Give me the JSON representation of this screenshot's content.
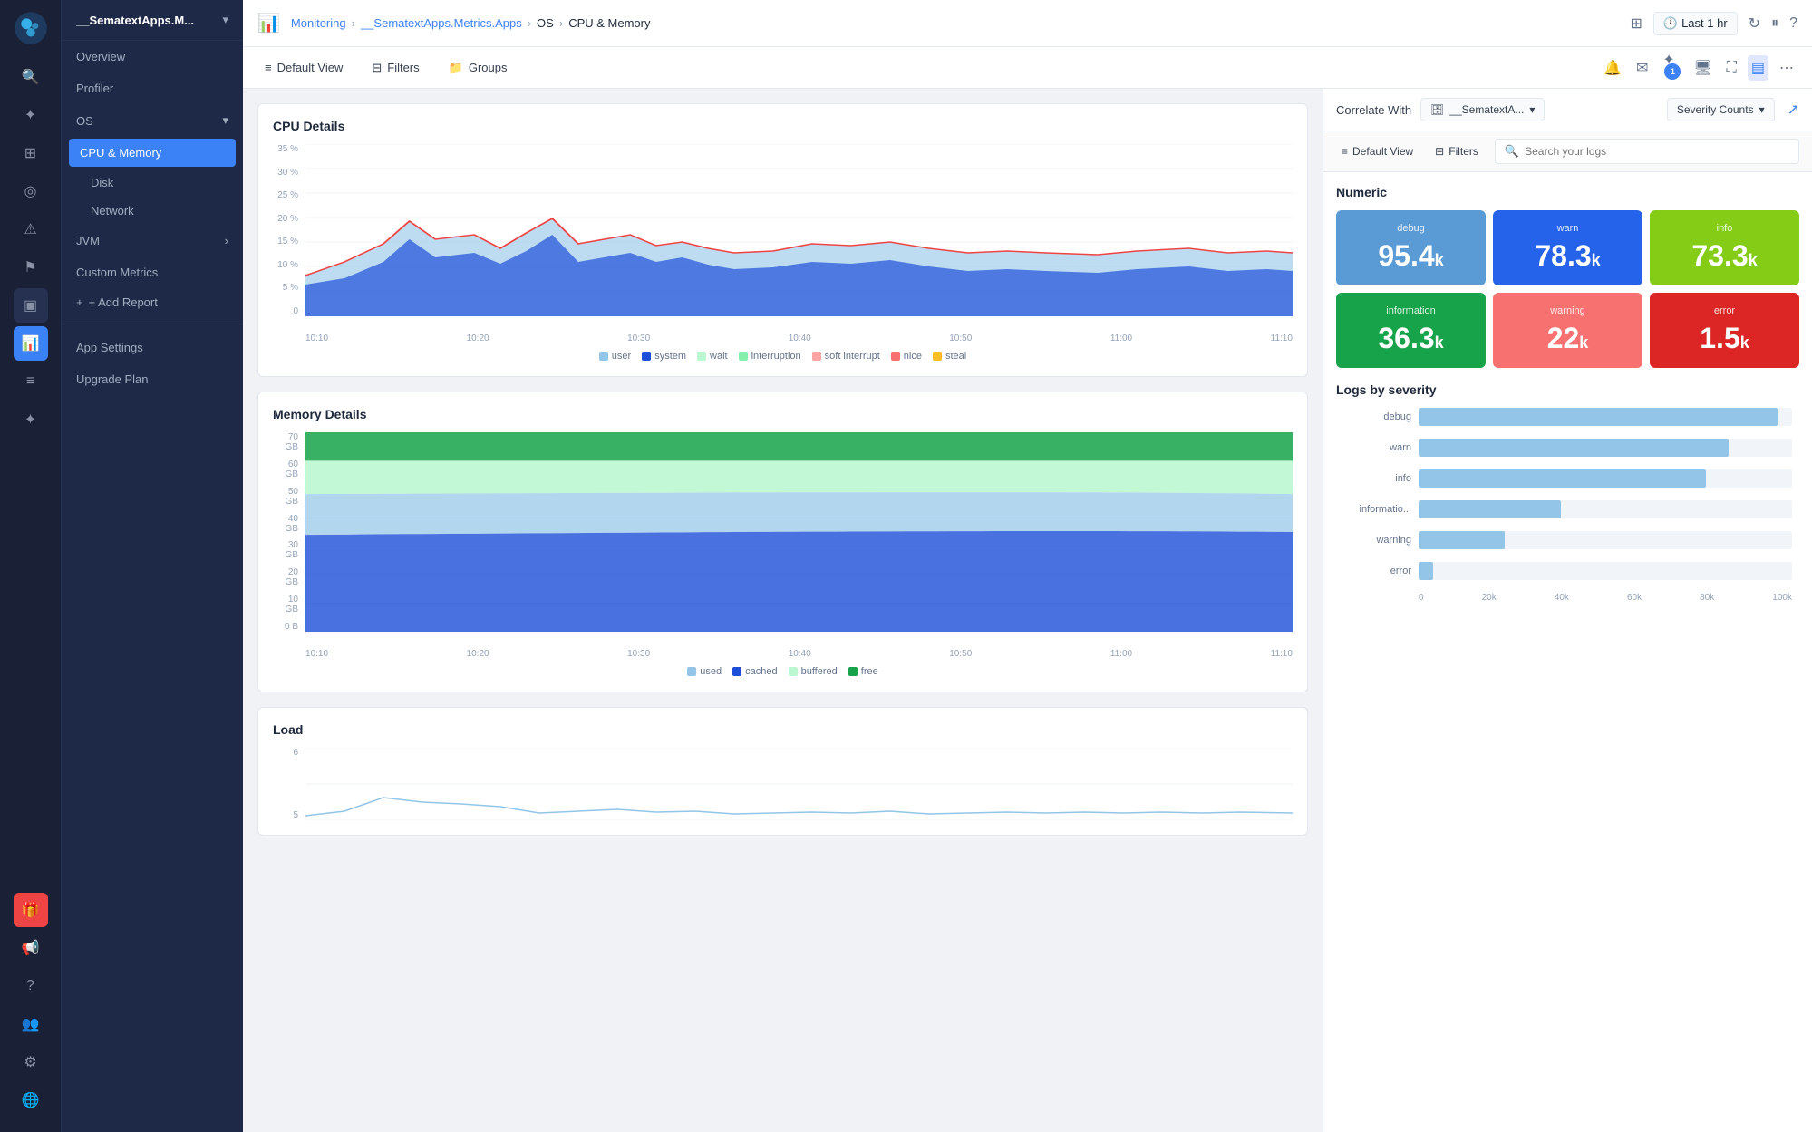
{
  "app": {
    "title": "__SematextApps.M...",
    "logo_label": "Sematext logo"
  },
  "breadcrumb": {
    "items": [
      "Monitoring",
      "__SematextApps.Metrics.Apps",
      "OS",
      "CPU & Memory"
    ]
  },
  "topbar": {
    "time_label": "Last 1 hr",
    "refresh_icon": "↻",
    "pause_icon": "⏸",
    "help_icon": "?"
  },
  "toolbar": {
    "default_view_label": "Default View",
    "filters_label": "Filters",
    "groups_label": "Groups"
  },
  "nav": {
    "app_title": "__SematextApps.M...",
    "items": [
      {
        "label": "Overview",
        "active": false
      },
      {
        "label": "Profiler",
        "active": false
      },
      {
        "label": "OS",
        "active": false,
        "expandable": true
      },
      {
        "label": "CPU & Memory",
        "active": true,
        "sub": true
      },
      {
        "label": "Disk",
        "active": false,
        "sub": true
      },
      {
        "label": "Network",
        "active": false,
        "sub": true
      },
      {
        "label": "JVM",
        "active": false,
        "expandable": true
      },
      {
        "label": "Custom Metrics",
        "active": false
      },
      {
        "label": "+ Add Report",
        "active": false
      }
    ],
    "bottom_items": [
      "App Settings",
      "Upgrade Plan"
    ]
  },
  "cpu_chart": {
    "title": "CPU Details",
    "y_labels": [
      "35 %",
      "30 %",
      "25 %",
      "20 %",
      "15 %",
      "10 %",
      "5 %",
      "0"
    ],
    "x_labels": [
      "10:10",
      "10:20",
      "10:30",
      "10:40",
      "10:50",
      "11:00",
      "11:10"
    ],
    "legend": [
      {
        "label": "user",
        "color": "#93c5e8"
      },
      {
        "label": "system",
        "color": "#1d4ed8"
      },
      {
        "label": "wait",
        "color": "#bbf7d0"
      },
      {
        "label": "interruption",
        "color": "#86efac"
      },
      {
        "label": "soft interrupt",
        "color": "#fca5a5"
      },
      {
        "label": "nice",
        "color": "#f87171"
      },
      {
        "label": "steal",
        "color": "#fbbf24"
      }
    ]
  },
  "memory_chart": {
    "title": "Memory Details",
    "y_labels": [
      "70 GB",
      "60 GB",
      "50 GB",
      "40 GB",
      "30 GB",
      "20 GB",
      "10 GB",
      "0 B"
    ],
    "x_labels": [
      "10:10",
      "10:20",
      "10:30",
      "10:40",
      "10:50",
      "11:00",
      "11:10"
    ],
    "legend": [
      {
        "label": "used",
        "color": "#93c5e8"
      },
      {
        "label": "cached",
        "color": "#1d4ed8"
      },
      {
        "label": "buffered",
        "color": "#bbf7d0"
      },
      {
        "label": "free",
        "color": "#16a34a"
      }
    ]
  },
  "load_chart": {
    "title": "Load",
    "y_labels": [
      "6",
      "5"
    ]
  },
  "correlate": {
    "label": "Correlate With",
    "app_name": "__SematextA...",
    "severity_label": "Severity Counts",
    "external_icon": "↗"
  },
  "right_toolbar": {
    "default_view_label": "Default View",
    "filters_label": "Filters",
    "search_placeholder": "Search your logs"
  },
  "severity_section": {
    "title": "Numeric",
    "cards": [
      {
        "label": "debug",
        "value": "95.4",
        "sub": "k",
        "class": "card-debug"
      },
      {
        "label": "warn",
        "value": "78.3",
        "sub": "k",
        "class": "card-warn"
      },
      {
        "label": "info",
        "value": "73.3",
        "sub": "k",
        "class": "card-info"
      },
      {
        "label": "information",
        "value": "36.3",
        "sub": "k",
        "class": "card-information"
      },
      {
        "label": "warning",
        "value": "22",
        "sub": "k",
        "class": "card-warning"
      },
      {
        "label": "error",
        "value": "1.5",
        "sub": "k",
        "class": "card-error"
      }
    ]
  },
  "logs_by_severity": {
    "title": "Logs by severity",
    "bars": [
      {
        "label": "debug",
        "value": 95.4,
        "max": 100,
        "width_pct": 96
      },
      {
        "label": "warn",
        "value": 78.3,
        "max": 100,
        "width_pct": 83
      },
      {
        "label": "info",
        "value": 73.3,
        "max": 100,
        "width_pct": 77
      },
      {
        "label": "informatio...",
        "value": 36.3,
        "max": 100,
        "width_pct": 38
      },
      {
        "label": "warning",
        "value": 22,
        "max": 100,
        "width_pct": 23
      },
      {
        "label": "error",
        "value": 1.5,
        "max": 100,
        "width_pct": 4
      }
    ],
    "x_labels": [
      "0",
      "20k",
      "40k",
      "60k",
      "80k",
      "100k"
    ]
  },
  "sidebar_icons": [
    {
      "name": "home-icon",
      "symbol": "⌂",
      "active": false
    },
    {
      "name": "rocket-icon",
      "symbol": "🚀",
      "active": false,
      "unicode": "✦"
    },
    {
      "name": "grid-icon",
      "symbol": "⊞",
      "active": false
    },
    {
      "name": "globe-icon",
      "symbol": "◎",
      "active": false
    },
    {
      "name": "alert-icon",
      "symbol": "⚠",
      "active": false
    },
    {
      "name": "flag-icon",
      "symbol": "⚑",
      "active": false
    },
    {
      "name": "box-icon",
      "symbol": "▣",
      "active": false
    },
    {
      "name": "chart-icon",
      "symbol": "📊",
      "active": true
    },
    {
      "name": "list-icon",
      "symbol": "≡",
      "active": false
    },
    {
      "name": "puzzle-icon",
      "symbol": "✦",
      "active": false
    },
    {
      "name": "gift-icon",
      "symbol": "🎁",
      "active": false,
      "special": "gift"
    },
    {
      "name": "bell-icon",
      "symbol": "🔔",
      "active": false
    },
    {
      "name": "users-icon",
      "symbol": "👥",
      "active": false
    },
    {
      "name": "settings-icon",
      "symbol": "⚙",
      "active": false
    },
    {
      "name": "globe2-icon",
      "symbol": "🌐",
      "active": false
    }
  ]
}
